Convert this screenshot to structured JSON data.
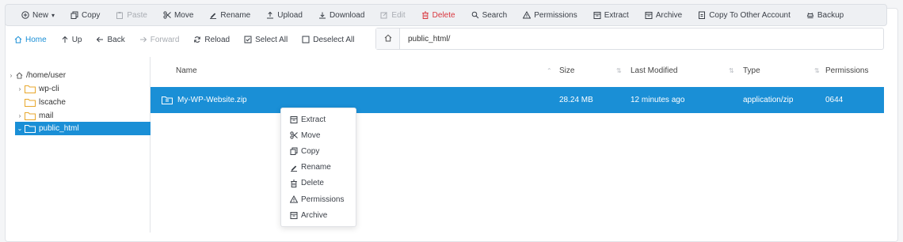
{
  "toolbar": {
    "items": [
      {
        "label": "New",
        "icon": "plus-circle-icon",
        "state": "normal"
      },
      {
        "label": "Copy",
        "icon": "copy-icon",
        "state": "normal"
      },
      {
        "label": "Paste",
        "icon": "paste-icon",
        "state": "disabled"
      },
      {
        "label": "Move",
        "icon": "scissors-icon",
        "state": "normal"
      },
      {
        "label": "Rename",
        "icon": "pencil-icon",
        "state": "normal"
      },
      {
        "label": "Upload",
        "icon": "upload-icon",
        "state": "normal"
      },
      {
        "label": "Download",
        "icon": "download-icon",
        "state": "normal"
      },
      {
        "label": "Edit",
        "icon": "edit-icon",
        "state": "disabled"
      },
      {
        "label": "Delete",
        "icon": "trash-icon",
        "state": "danger"
      },
      {
        "label": "Search",
        "icon": "search-icon",
        "state": "normal"
      },
      {
        "label": "Permissions",
        "icon": "warning-icon",
        "state": "normal"
      },
      {
        "label": "Extract",
        "icon": "extract-icon",
        "state": "normal"
      },
      {
        "label": "Archive",
        "icon": "archive-icon",
        "state": "normal"
      },
      {
        "label": "Copy To Other Account",
        "icon": "copy-account-icon",
        "state": "normal"
      },
      {
        "label": "Backup",
        "icon": "backup-icon",
        "state": "normal"
      }
    ]
  },
  "nav": {
    "home": "Home",
    "up": "Up",
    "back": "Back",
    "forward": "Forward",
    "reload": "Reload",
    "select_all": "Select All",
    "deselect_all": "Deselect All"
  },
  "path": {
    "value": "public_html/"
  },
  "tree": {
    "root": "/home/user",
    "items": [
      "wp-cli",
      "lscache",
      "mail",
      "public_html"
    ]
  },
  "table": {
    "columns": [
      "Name",
      "Size",
      "Last Modified",
      "Type",
      "Permissions"
    ],
    "rows": [
      {
        "name": "My-WP-Website.zip",
        "size": "28.24 MB",
        "modified": "12 minutes ago",
        "type": "application/zip",
        "permissions": "0644"
      }
    ]
  },
  "context_menu": {
    "items": [
      "Extract",
      "Move",
      "Copy",
      "Rename",
      "Delete",
      "Permissions",
      "Archive"
    ]
  },
  "colors": {
    "accent": "#1a8fd6",
    "danger": "#d9363e",
    "folder": "#e8a72c"
  }
}
